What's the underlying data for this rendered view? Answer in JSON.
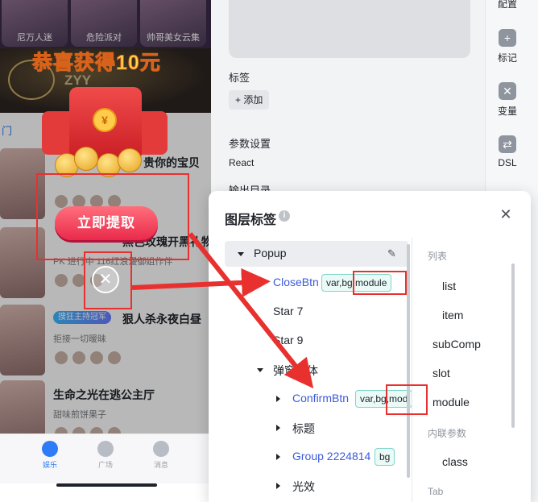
{
  "phone": {
    "tiles": [
      {
        "caption": "尼万人迷"
      },
      {
        "caption": "危险派对"
      },
      {
        "caption": "帅哥美女云集"
      }
    ],
    "win_title": "恭喜获得10元",
    "tabs": [
      "门"
    ],
    "rows": [
      {
        "title": "贵你的宝贝",
        "subtitle": "",
        "badge": ""
      },
      {
        "title": "黑色玫瑰开黑礼物",
        "subtitle": "PK 进行中 116红浪漫御姐作伴",
        "badge": ""
      },
      {
        "title": "狠人杀永夜白昼",
        "subtitle": "拒接一切暧昧",
        "badge": "搜狂主持冠军"
      },
      {
        "title": "生命之光在逃公主厅",
        "subtitle": "甜味煎饼果子",
        "badge": ""
      }
    ],
    "claim_button": "立即提取",
    "close_glyph": "✕",
    "bottom_nav": [
      {
        "label": "娱乐",
        "active": true
      },
      {
        "label": "广场",
        "active": false
      },
      {
        "label": "消息",
        "active": false
      }
    ]
  },
  "editor": {
    "tags_label": "标签",
    "add_label": "+ 添加",
    "params_label": "参数设置",
    "framework_value": "React",
    "output_label": "输出目录"
  },
  "sidebar": {
    "items": [
      {
        "label": "配置",
        "icon": "settings-icon"
      },
      {
        "label": "标记",
        "icon": "plus-icon"
      },
      {
        "label": "变量",
        "icon": "close-square-icon"
      },
      {
        "label": "DSL",
        "icon": "dsl-icon"
      }
    ]
  },
  "dialog": {
    "title": "图层标签",
    "info_glyph": "i",
    "close_glyph": "✕",
    "tree": [
      {
        "label": "Popup",
        "tags": [],
        "link": false
      },
      {
        "label": "CloseBtn",
        "tags": [
          "var,bg,module"
        ],
        "link": true
      },
      {
        "label": "Star 7",
        "tags": [],
        "link": false
      },
      {
        "label": "Star 9",
        "tags": [],
        "link": false
      },
      {
        "label": "弹窗主体",
        "tags": [],
        "link": false
      },
      {
        "label": "ConfirmBtn",
        "tags": [
          "var,bg,mod"
        ],
        "link": true
      },
      {
        "label": "标题",
        "tags": [],
        "link": false
      },
      {
        "label": "Group 2224814",
        "tags": [
          "bg"
        ],
        "link": true
      },
      {
        "label": "光效",
        "tags": [],
        "link": false
      }
    ],
    "list_pane": {
      "section_list": "列表",
      "items": [
        "list",
        "item",
        "subComp",
        "slot",
        "module"
      ],
      "section_inline": "内联参数",
      "inline_items": [
        "class"
      ],
      "section_tab": "Tab"
    }
  },
  "colors": {
    "highlight_red": "#e8312f",
    "link_blue": "#3b5bdb",
    "tag_border": "#7fd6c8"
  }
}
